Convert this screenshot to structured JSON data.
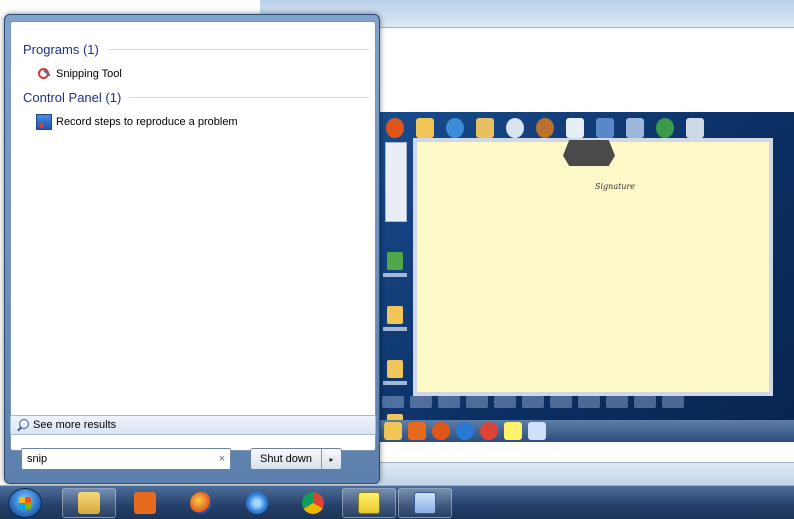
{
  "start_menu": {
    "groups": [
      {
        "title": "Programs (1)",
        "items": [
          {
            "label": "Snipping Tool",
            "icon": "scissors-icon"
          }
        ]
      },
      {
        "title": "Control Panel (1)",
        "items": [
          {
            "label": "Record steps to reproduce a problem",
            "icon": "steps-recorder-icon"
          }
        ]
      }
    ],
    "see_more_label": "See more results",
    "search": {
      "value": "snip",
      "clear_glyph": "×"
    },
    "shutdown": {
      "label": "Shut down",
      "arrow_glyph": "▸"
    }
  },
  "nested_screenshot": {
    "note_text": "Signature"
  },
  "taskbar": {
    "items": [
      {
        "icon": "windows-explorer-icon"
      },
      {
        "icon": "media-player-icon"
      },
      {
        "icon": "firefox-icon"
      },
      {
        "icon": "internet-explorer-icon"
      },
      {
        "icon": "chrome-icon"
      },
      {
        "icon": "snipping-tool-icon"
      },
      {
        "icon": "word-icon"
      }
    ]
  }
}
